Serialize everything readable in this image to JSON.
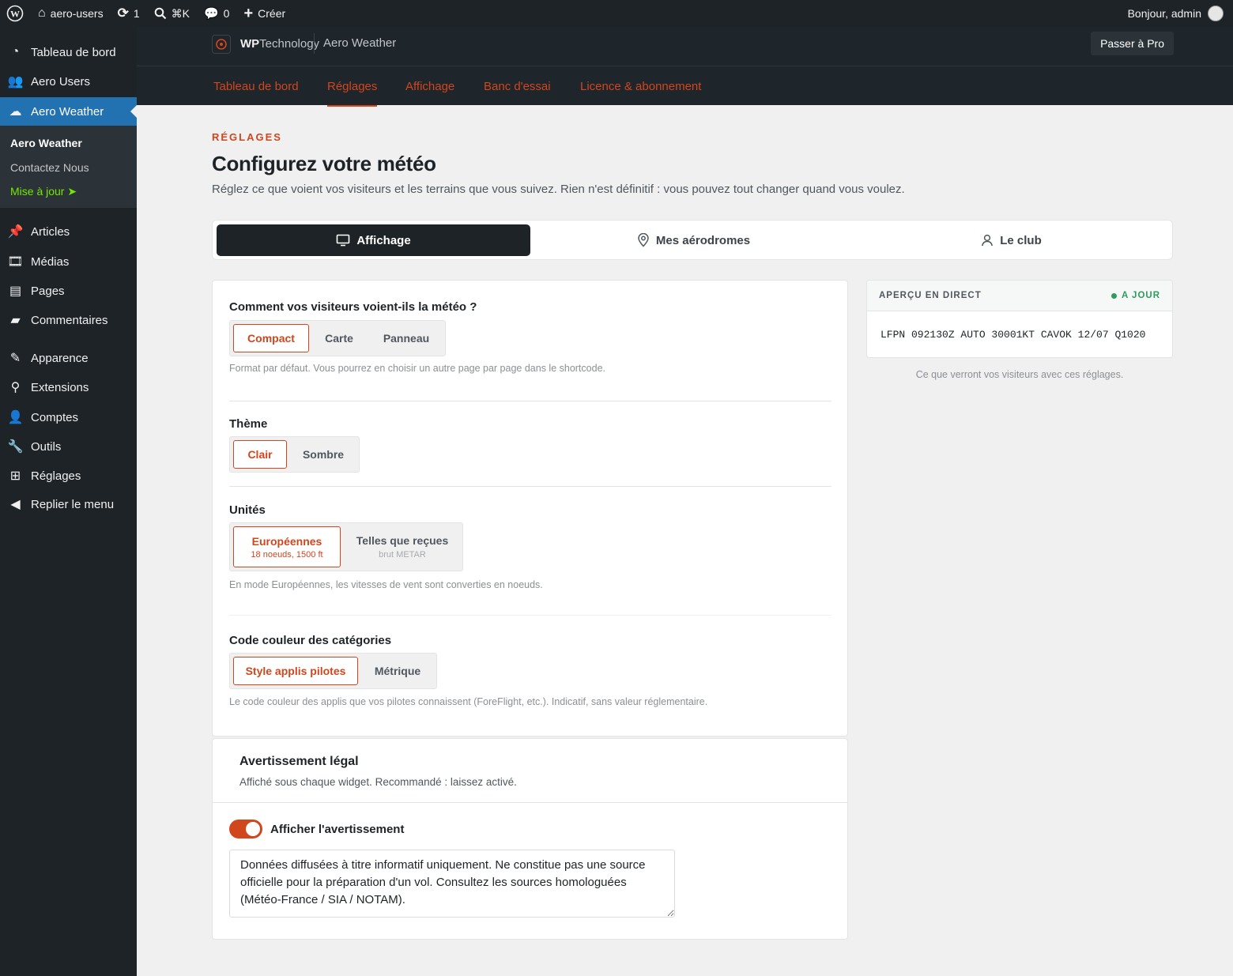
{
  "adminbar": {
    "site_name": "aero-users",
    "updates_count": "1",
    "search_shortcut": "⌘K",
    "comments_count": "0",
    "new_label": "Créer",
    "greeting": "Bonjour, admin"
  },
  "sidebar": {
    "items": [
      {
        "label": "Tableau de bord",
        "icon": "dashboard-icon"
      },
      {
        "label": "Aero Users",
        "icon": "users-icon"
      },
      {
        "label": "Aero Weather",
        "icon": "cloud-icon"
      },
      {
        "label": "Articles",
        "icon": "pin-icon"
      },
      {
        "label": "Médias",
        "icon": "media-icon"
      },
      {
        "label": "Pages",
        "icon": "pages-icon"
      },
      {
        "label": "Commentaires",
        "icon": "comment-icon"
      },
      {
        "label": "Apparence",
        "icon": "brush-icon"
      },
      {
        "label": "Extensions",
        "icon": "plugin-icon"
      },
      {
        "label": "Comptes",
        "icon": "user-icon"
      },
      {
        "label": "Outils",
        "icon": "wrench-icon"
      },
      {
        "label": "Réglages",
        "icon": "settings-icon"
      },
      {
        "label": "Replier le menu",
        "icon": "collapse-icon"
      }
    ],
    "submenu": [
      "Aero Weather",
      "Contactez Nous",
      "Mise à jour"
    ]
  },
  "plugin": {
    "brand_wp": "WP",
    "brand_tech": "Technology",
    "product": "Aero Weather",
    "pro_button": "Passer à Pro",
    "nav": [
      "Tableau de bord",
      "Réglages",
      "Affichage",
      "Banc d'essai",
      "Licence & abonnement"
    ]
  },
  "page": {
    "eyebrow": "RÉGLAGES",
    "title": "Configurez votre météo",
    "lead": "Réglez ce que voient vos visiteurs et les terrains que vous suivez. Rien n'est définitif : vous pouvez tout changer quand vous voulez."
  },
  "tabs": [
    "Affichage",
    "Mes aérodromes",
    "Le club"
  ],
  "settings": {
    "format": {
      "label": "Comment vos visiteurs voient-ils la météo ?",
      "options": [
        "Compact",
        "Carte",
        "Panneau"
      ],
      "hint": "Format par défaut. Vous pourrez en choisir un autre page par page dans le shortcode."
    },
    "theme": {
      "label": "Thème",
      "options": [
        "Clair",
        "Sombre"
      ]
    },
    "units": {
      "label": "Unités",
      "options": [
        {
          "title": "Européennes",
          "sub": "18 noeuds, 1500 ft"
        },
        {
          "title": "Telles que reçues",
          "sub": "brut METAR"
        }
      ],
      "hint": "En mode Européennes, les vitesses de vent sont converties en noeuds."
    },
    "colors": {
      "label": "Code couleur des catégories",
      "options": [
        "Style applis pilotes",
        "Métrique"
      ],
      "hint": "Le code couleur des applis que vos pilotes connaissent (ForeFlight, etc.). Indicatif, sans valeur réglementaire."
    }
  },
  "legal": {
    "title": "Avertissement légal",
    "desc": "Affiché sous chaque widget. Recommandé : laissez activé.",
    "toggle_label": "Afficher l'avertissement",
    "text": "Données diffusées à titre informatif uniquement. Ne constitue pas une source officielle pour la préparation d'un vol. Consultez les sources homologuées (Météo-France / SIA / NOTAM)."
  },
  "preview": {
    "title": "APERÇU EN DIRECT",
    "status": "A JOUR",
    "metar": "LFPN 092130Z AUTO 30001KT CAVOK 12/07 Q1020",
    "caption": "Ce que verront vos visiteurs avec ces réglages."
  },
  "colors": {
    "accent": "#d0461d",
    "admin_dark": "#1d2327",
    "wp_blue": "#2271b1",
    "status_green": "#2e9b5f"
  }
}
